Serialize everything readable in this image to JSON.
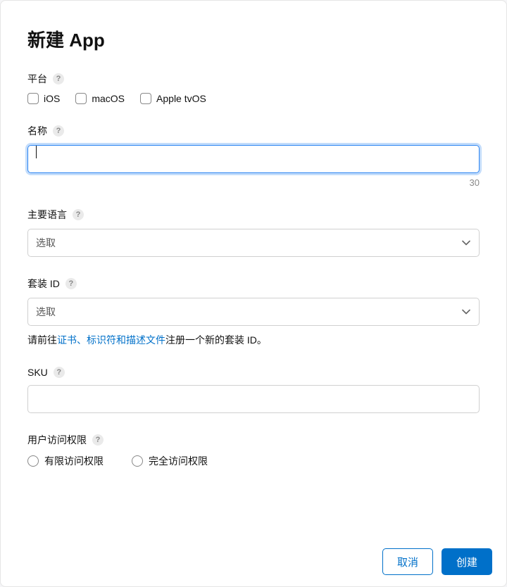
{
  "title": "新建 App",
  "platform": {
    "label": "平台",
    "options": {
      "ios": "iOS",
      "macos": "macOS",
      "tvos": "Apple tvOS"
    }
  },
  "name": {
    "label": "名称",
    "value": "",
    "remaining": "30"
  },
  "primaryLanguage": {
    "label": "主要语言",
    "selected": "选取"
  },
  "bundleId": {
    "label": "套装 ID",
    "selected": "选取",
    "hint_prefix": "请前往",
    "hint_link": "证书、标识符和描述文件",
    "hint_suffix": "注册一个新的套装 ID。"
  },
  "sku": {
    "label": "SKU",
    "value": ""
  },
  "userAccess": {
    "label": "用户访问权限",
    "options": {
      "limited": "有限访问权限",
      "full": "完全访问权限"
    }
  },
  "footer": {
    "cancel": "取消",
    "create": "创建"
  }
}
